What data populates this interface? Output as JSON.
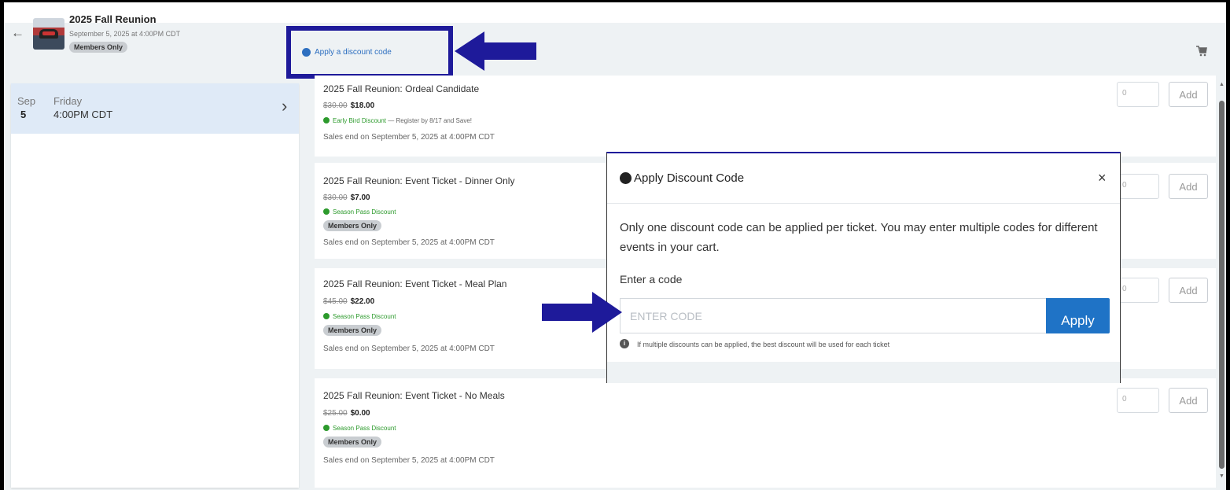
{
  "event": {
    "title": "2025 Fall Reunion",
    "date": "September 5, 2025 at 4:00PM CDT",
    "badge": "Members Only"
  },
  "header": {
    "discount_link": "Apply a discount code",
    "cart_icon": "cart-icon"
  },
  "sidebar": {
    "date_item": {
      "month": "Sep",
      "day": "5",
      "weekday": "Friday",
      "time": "4:00PM CDT"
    }
  },
  "tickets": [
    {
      "name": "2025 Fall Reunion: Ordeal Candidate",
      "old_price": "$30.00",
      "price": "$18.00",
      "discount": "Early Bird Discount",
      "discount_note": "— Register by 8/17 and Save!",
      "badge": "",
      "sales": "Sales end on September 5, 2025 at 4:00PM CDT",
      "qty": "0",
      "add_label": "Add"
    },
    {
      "name": "2025 Fall Reunion: Event Ticket - Dinner Only",
      "old_price": "$30.00",
      "price": "$7.00",
      "discount": "Season Pass Discount",
      "badge": "Members Only",
      "sales": "Sales end on September 5, 2025 at 4:00PM CDT",
      "qty": "0",
      "add_label": "Add"
    },
    {
      "name": "2025 Fall Reunion: Event Ticket - Meal Plan",
      "old_price": "$45.00",
      "price": "$22.00",
      "discount": "Season Pass Discount",
      "badge": "Members Only",
      "sales": "Sales end on September 5, 2025 at 4:00PM CDT",
      "qty": "0",
      "add_label": "Add"
    },
    {
      "name": "2025 Fall Reunion: Event Ticket - No Meals",
      "old_price": "$25.00",
      "price": "$0.00",
      "discount": "Season Pass Discount",
      "badge": "Members Only",
      "sales": "Sales end on September 5, 2025 at 4:00PM CDT",
      "qty": "0",
      "add_label": "Add"
    }
  ],
  "modal": {
    "title": "Apply Discount Code",
    "close": "×",
    "body": "Only one discount code can be applied per ticket. You may enter multiple codes for different events in your cart.",
    "label": "Enter a code",
    "placeholder": "ENTER CODE",
    "apply_label": "Apply",
    "hint": "If multiple discounts can be applied, the best discount will be used for each ticket",
    "hint_icon": "i"
  },
  "colors": {
    "annotation": "#1e1a9a",
    "primary": "#1f73c6",
    "discount": "#2c9a2c"
  }
}
